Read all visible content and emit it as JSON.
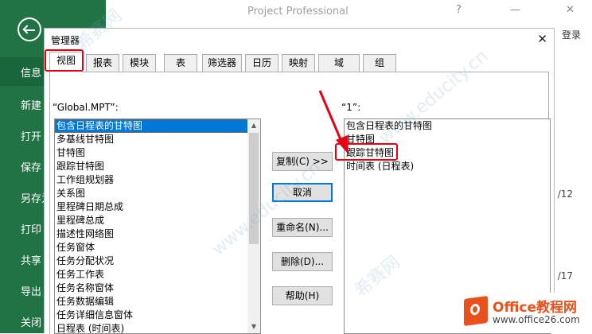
{
  "app": {
    "title": "Project Professional",
    "help_glyph": "?",
    "minimize_glyph": "—",
    "close_glyph": "✕",
    "login": "登录",
    "right_text_1": "/12",
    "right_text_2": "/17"
  },
  "backstage": {
    "back_icon": "back-arrow-icon",
    "items": [
      {
        "label": "信息",
        "selected": true
      },
      {
        "label": "新建"
      },
      {
        "label": "打开"
      },
      {
        "label": "保存"
      },
      {
        "label": "另存为"
      },
      {
        "label": "打印"
      },
      {
        "label": "共享"
      },
      {
        "label": "导出"
      },
      {
        "label": "关闭"
      }
    ]
  },
  "dialog": {
    "title": "管理器",
    "close_glyph": "✕",
    "tabs": [
      "视图",
      "报表",
      "模块",
      "表",
      "筛选器",
      "日历",
      "映射",
      "域",
      "组"
    ],
    "active_tab": "视图",
    "left_label": "“Global.MPT”:",
    "right_label": "“1”:",
    "left_items": [
      "包含日程表的甘特图",
      "多基线甘特图",
      "甘特图",
      "跟踪甘特图",
      "工作组规划器",
      "关系图",
      "里程碑日期总成",
      "里程碑总成",
      "描述性网络图",
      "任务窗体",
      "任务分配状况",
      "任务工作表",
      "任务名称窗体",
      "任务数据编辑",
      "任务详细信息窗体",
      "日程表 (时间表)"
    ],
    "right_items": [
      "包含日程表的甘特图",
      "甘特图",
      "跟踪甘特图",
      "时间表 (日程表)"
    ],
    "buttons": {
      "copy": "复制(C) >>",
      "cancel": "取消",
      "rename": "重命名(N)...",
      "delete": "删除(D)...",
      "help": "帮助(H)"
    },
    "scroll_up": "▲",
    "scroll_down": "▼"
  },
  "watermark": {
    "text1": "希赛网",
    "text2": "www.educity.cn"
  },
  "logo": {
    "brand": "Office教程网",
    "url": "www.office26.com"
  },
  "colors": {
    "backstage": "#217346",
    "selection": "#0078d7",
    "highlight_red": "#e60012",
    "logo_orange": "#e8501c"
  }
}
